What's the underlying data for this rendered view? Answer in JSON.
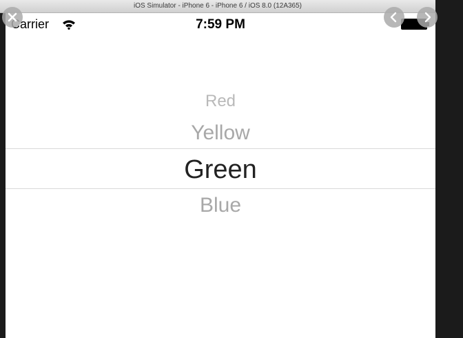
{
  "window": {
    "title": "iOS Simulator - iPhone 6 - iPhone 6 / iOS 8.0 (12A365)"
  },
  "statusbar": {
    "carrier": "Carrier",
    "time": "7:59 PM",
    "wifi_icon": "wifi-icon",
    "battery_icon": "battery-icon"
  },
  "picker": {
    "items": [
      {
        "label": "Red"
      },
      {
        "label": "Yellow"
      },
      {
        "label": "Green"
      },
      {
        "label": "Blue"
      }
    ],
    "selected": "Green"
  },
  "overlay": {
    "close_icon": "close-icon",
    "prev_icon": "chevron-left-icon",
    "next_icon": "chevron-right-icon"
  }
}
